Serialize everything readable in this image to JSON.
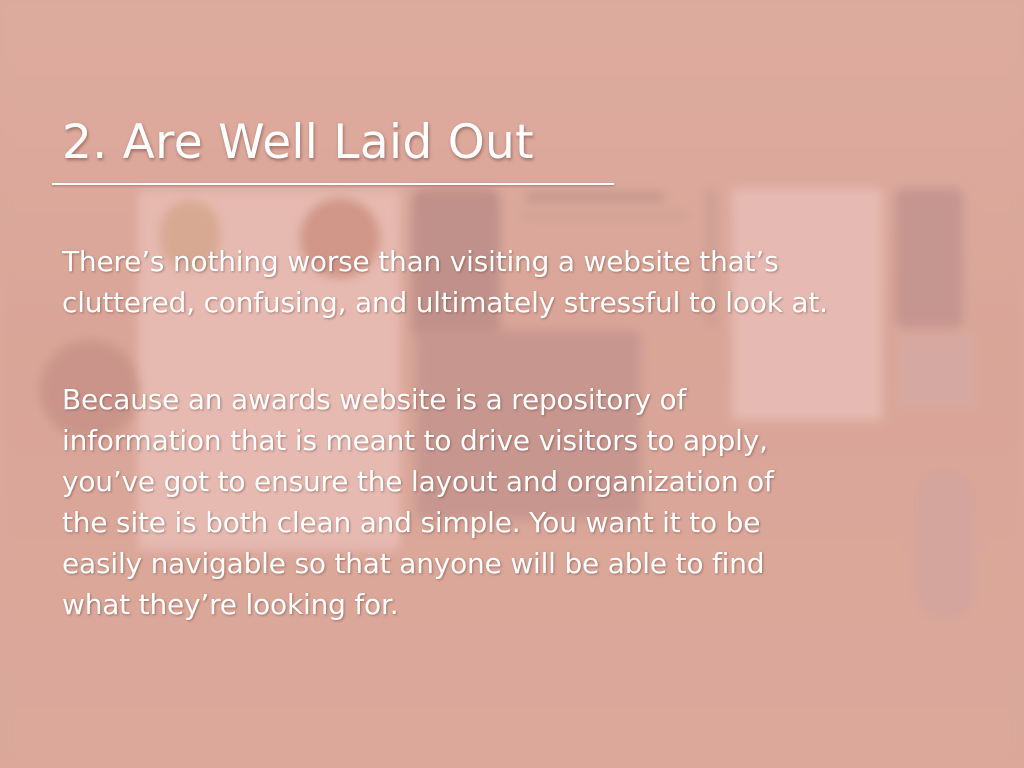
{
  "slide": {
    "title": "2. Are Well Laid Out",
    "paragraph_1": "There’s nothing worse than visiting a website that’s\ncluttered, confusing, and ultimately stressful to look at.",
    "paragraph_2": "Because an awards website is a repository of\ninformation that is meant to drive visitors to apply,\nyou’ve got to ensure the layout and organization of\nthe site is both clean and simple. You want it to be\neasily navigable so that anyone will be able to find\nwhat they’re looking for."
  },
  "colors": {
    "background": "#d7a99a",
    "text": "#ffffff"
  }
}
